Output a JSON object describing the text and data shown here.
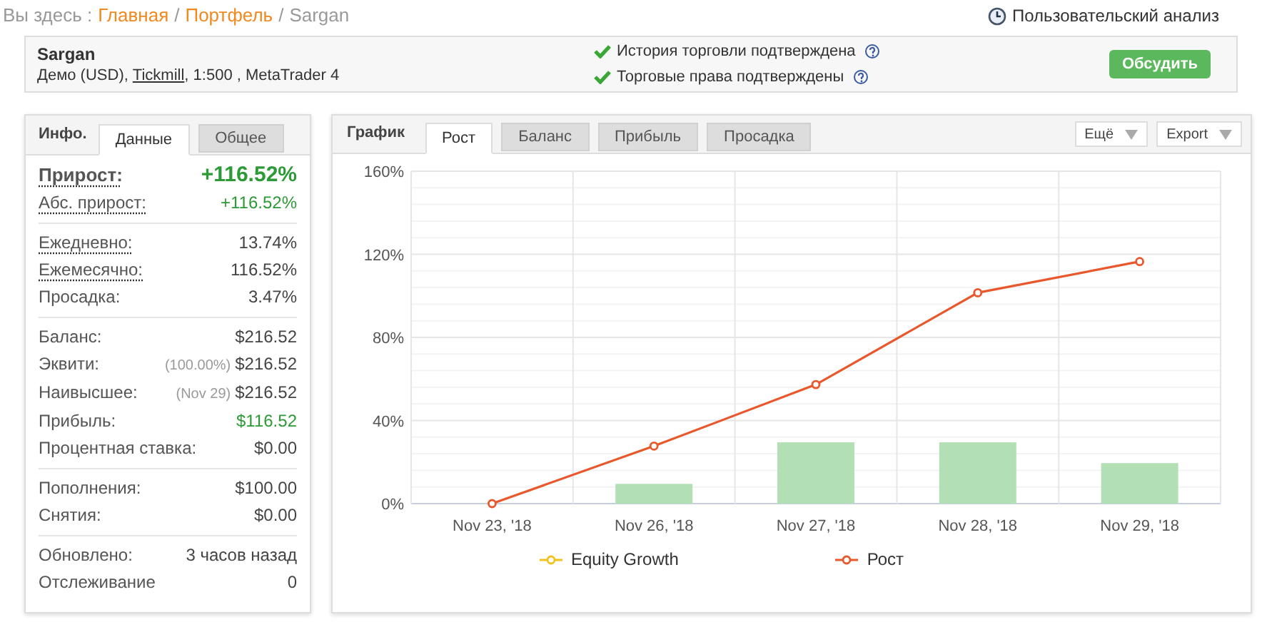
{
  "breadcrumb": {
    "prefix": "Вы здесь :",
    "links": [
      {
        "label": "Главная",
        "separator": "/"
      },
      {
        "label": "Портфель",
        "separator": "/"
      }
    ],
    "current": "Sargan"
  },
  "custom_analysis": {
    "label": "Пользовательский анализ"
  },
  "account": {
    "name": "Sargan",
    "details_before": "Демо (USD),",
    "broker": "Tickmill",
    "details_after": ", 1:500 , MetaTrader 4",
    "verifications": [
      {
        "label": "История торговли подтверждена",
        "verified": true
      },
      {
        "label": "Торговые права подтверждены",
        "verified": true
      }
    ],
    "discuss_button": "Обсудить"
  },
  "info_panel": {
    "title": "Инфо.",
    "tabs": [
      {
        "label": "Данные",
        "selected": true
      },
      {
        "label": "Общее",
        "selected": false
      }
    ],
    "sections": [
      [
        {
          "label": "Прирост:",
          "value": "+116.52%",
          "dotted": true,
          "positive": true,
          "large": true
        },
        {
          "label": "Абс. прирост:",
          "value": "+116.52%",
          "dotted": true,
          "positive": true
        }
      ],
      [
        {
          "label": "Ежедневно:",
          "value": "13.74%",
          "dotted": true,
          "positive": false
        },
        {
          "label": "Ежемесячно:",
          "value": "116.52%",
          "dotted": true,
          "positive": false
        },
        {
          "label": "Просадка:",
          "value": "3.47%",
          "dotted": false,
          "positive": false
        }
      ],
      [
        {
          "label": "Баланс:",
          "value": "$216.52",
          "dotted": false,
          "positive": false
        },
        {
          "label": "Эквити:",
          "note": "(100.00%)",
          "value": "$216.52",
          "dotted": false,
          "positive": false
        },
        {
          "label": "Наивысшее:",
          "note": "(Nov 29)",
          "value": "$216.52",
          "dotted": false,
          "positive": false
        },
        {
          "label": "Прибыль:",
          "value": "$116.52",
          "dotted": false,
          "positive": true
        },
        {
          "label": "Процентная ставка:",
          "value": "$0.00",
          "dotted": false,
          "positive": false
        }
      ],
      [
        {
          "label": "Пополнения:",
          "value": "$100.00",
          "dotted": false,
          "positive": false
        },
        {
          "label": "Снятия:",
          "value": "$0.00",
          "dotted": false,
          "positive": false
        }
      ],
      [
        {
          "label": "Обновлено:",
          "value": "3 часов назад",
          "dotted": false,
          "positive": false
        },
        {
          "label": "Отслеживание",
          "value": "0",
          "dotted": false,
          "positive": false
        }
      ]
    ]
  },
  "chart_panel": {
    "title": "График",
    "tabs": [
      {
        "label": "Рост",
        "selected": true
      },
      {
        "label": "Баланс",
        "selected": false
      },
      {
        "label": "Прибыль",
        "selected": false
      },
      {
        "label": "Просадка",
        "selected": false
      }
    ],
    "menus": [
      {
        "label": "Ещё"
      },
      {
        "label": "Export"
      }
    ],
    "chart_data": {
      "type": "line",
      "categories": [
        "Nov 23, '18",
        "Nov 26, '18",
        "Nov 27, '18",
        "Nov 28, '18",
        "Nov 29, '18"
      ],
      "ylim": [
        0,
        160
      ],
      "yticks": [
        {
          "value": 0,
          "label": "0%"
        },
        {
          "value": 40,
          "label": "40%"
        },
        {
          "value": 80,
          "label": "80%"
        },
        {
          "value": 120,
          "label": "120%"
        },
        {
          "value": 160,
          "label": "160%"
        }
      ],
      "series": [
        {
          "type": "bar",
          "color": "#b2e0b4",
          "values": [
            0,
            9.5,
            29.5,
            29.5,
            19.5
          ]
        },
        {
          "name": "Equity Growth",
          "color": "#f2c21b",
          "values": [
            null,
            null,
            null,
            null,
            null
          ]
        },
        {
          "name": "Рост",
          "color": "#e8582c",
          "marker": true,
          "values": [
            0,
            27.7,
            57.3,
            101.5,
            116.5
          ]
        }
      ],
      "grid": true
    }
  }
}
